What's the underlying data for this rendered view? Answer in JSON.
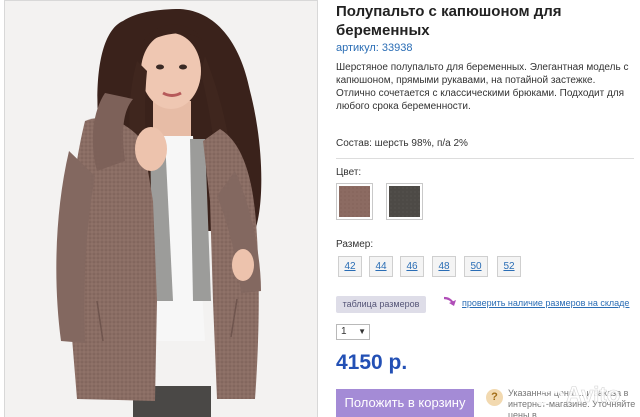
{
  "product": {
    "title": "Полупальто с капюшоном для беременных",
    "sku": "артикул: 33938",
    "description": "Шерстяное полупальто для беременных. Элегантная модель с капюшоном, прямыми рукавами, на потайной застежке. Отлично сочетается с классическими брюками. Подходит для любого срока беременности.",
    "composition": "Состав: шерсть 98%, п/а 2%"
  },
  "color": {
    "label": "Цвет:",
    "swatches": [
      {
        "name": "brown",
        "hex": "#8c6b62"
      },
      {
        "name": "dark-grey",
        "hex": "#4d4a46"
      }
    ]
  },
  "size": {
    "label": "Размер:",
    "options": [
      "42",
      "44",
      "46",
      "48",
      "50",
      "52"
    ]
  },
  "links": {
    "size_table": "таблица размеров",
    "check_sizes": "проверить наличие размеров на складе"
  },
  "quantity": {
    "selected": "1",
    "caret": "▼"
  },
  "price": "4150 р.",
  "cart": {
    "button": "Положить в корзину",
    "note_icon": "?",
    "note_text": "Указанная цена ... и заказа в интернет-магазине. Уточняйте цены в"
  },
  "watermark": "Avito",
  "colors": {
    "accent_link": "#2a6db5",
    "price": "#2350b5",
    "cart_button": "#a48bd6",
    "coat": "#8a6d64"
  }
}
